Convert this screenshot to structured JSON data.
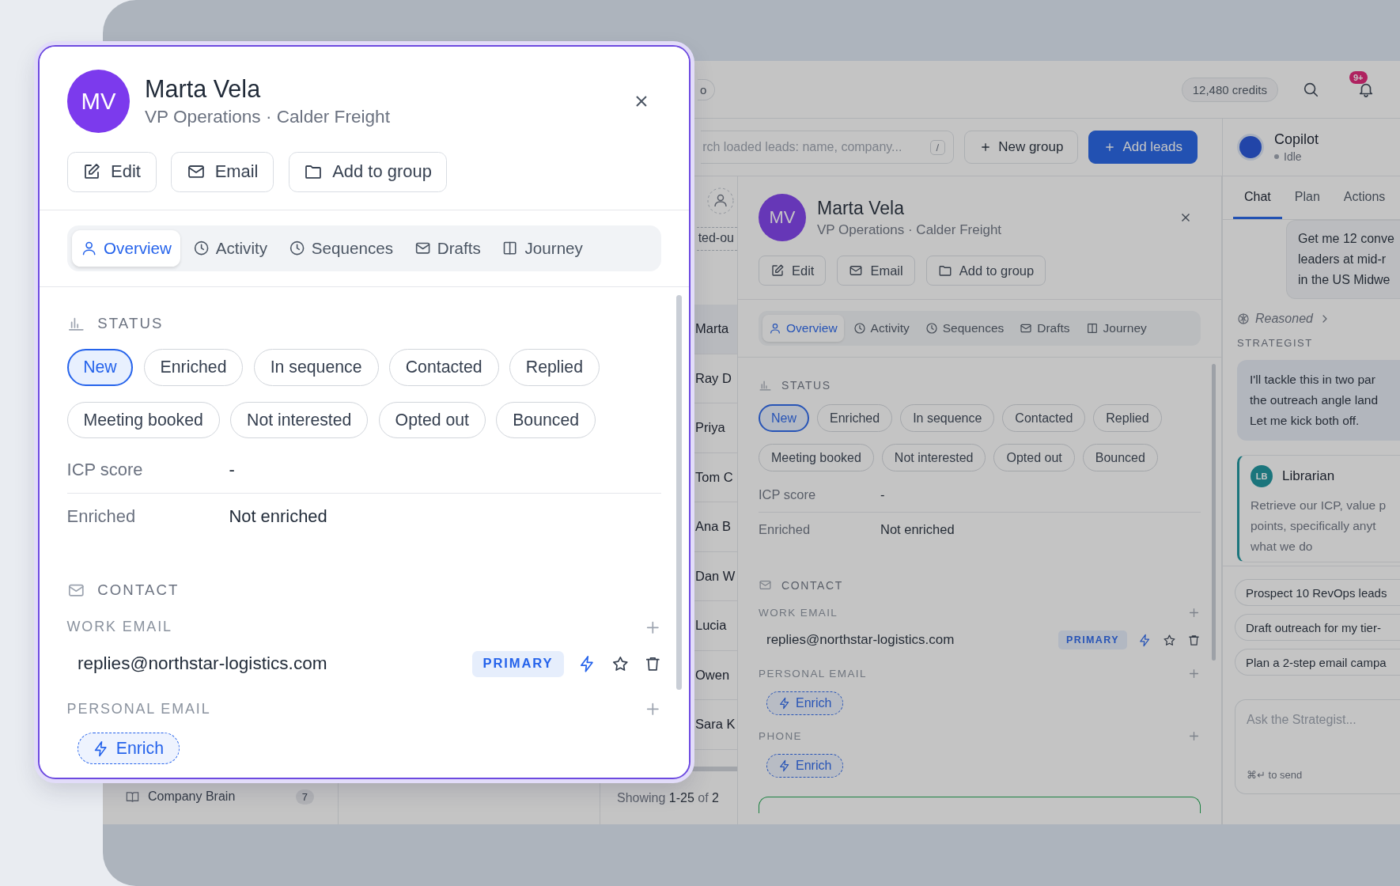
{
  "callout": {
    "avatar": "MV",
    "name": "Marta Vela",
    "subtitle": "VP Operations · Calder Freight",
    "actions": [
      "Edit",
      "Email",
      "Add to group"
    ],
    "tabs": [
      {
        "label": "Overview",
        "selected": true
      },
      {
        "label": "Activity",
        "selected": false
      },
      {
        "label": "Sequences",
        "selected": false
      },
      {
        "label": "Drafts",
        "selected": false
      },
      {
        "label": "Journey",
        "selected": false
      }
    ],
    "status": {
      "heading": "STATUS",
      "options": [
        {
          "label": "New",
          "selected": true
        },
        {
          "label": "Enriched",
          "selected": false
        },
        {
          "label": "In sequence",
          "selected": false
        },
        {
          "label": "Contacted",
          "selected": false
        },
        {
          "label": "Replied",
          "selected": false
        },
        {
          "label": "Meeting booked",
          "selected": false
        },
        {
          "label": "Not interested",
          "selected": false
        },
        {
          "label": "Opted out",
          "selected": false
        },
        {
          "label": "Bounced",
          "selected": false
        }
      ]
    },
    "fields": [
      {
        "label": "ICP score",
        "value": "-"
      },
      {
        "label": "Enriched",
        "value": "Not enriched"
      }
    ],
    "contact": {
      "heading": "CONTACT",
      "groups": [
        {
          "label": "WORK EMAIL",
          "kind": "email",
          "value": "replies@northstar-logistics.com",
          "badge": "PRIMARY"
        },
        {
          "label": "PERSONAL EMAIL",
          "kind": "enrich",
          "action": "Enrich"
        }
      ]
    }
  },
  "app": {
    "top_bar": {
      "pill_text": "o",
      "credits": "12,480 credits",
      "notifications": "9+"
    },
    "toolbar": {
      "search_placeholder": "rch loaded leads: name, company...",
      "shortcut": "/",
      "buttons": [
        {
          "label": "New group",
          "primary": false
        },
        {
          "label": "Add leads",
          "primary": true
        }
      ]
    },
    "sidebar": {
      "items": [
        {
          "label": "Company Brain",
          "count": "7"
        }
      ]
    },
    "leads": {
      "filter_chip": "ted-ou",
      "rows": [
        {
          "name": "Marta",
          "selected": true
        },
        {
          "name": "Ray D",
          "selected": false
        },
        {
          "name": "Priya",
          "selected": false
        },
        {
          "name": "Tom C",
          "selected": false
        },
        {
          "name": "Ana B",
          "selected": false
        },
        {
          "name": "Dan W",
          "selected": false
        },
        {
          "name": "Lucia",
          "selected": false
        },
        {
          "name": "Owen",
          "selected": false
        },
        {
          "name": "Sara K",
          "selected": false
        }
      ],
      "footer": "Showing **1-25** of **2**"
    },
    "detail": {
      "avatar": "MV",
      "name": "Marta Vela",
      "subtitle": "VP Operations · Calder Freight",
      "actions": [
        "Edit",
        "Email",
        "Add to group"
      ],
      "tabs": [
        {
          "label": "Overview",
          "selected": true
        },
        {
          "label": "Activity",
          "selected": false
        },
        {
          "label": "Sequences",
          "selected": false
        },
        {
          "label": "Drafts",
          "selected": false
        },
        {
          "label": "Journey",
          "selected": false
        }
      ],
      "status": {
        "heading": "STATUS",
        "options": [
          {
            "label": "New",
            "selected": true
          },
          {
            "label": "Enriched",
            "selected": false
          },
          {
            "label": "In sequence",
            "selected": false
          },
          {
            "label": "Contacted",
            "selected": false
          },
          {
            "label": "Replied",
            "selected": false
          },
          {
            "label": "Meeting booked",
            "selected": false
          },
          {
            "label": "Not interested",
            "selected": false
          },
          {
            "label": "Opted out",
            "selected": false
          },
          {
            "label": "Bounced",
            "selected": false
          }
        ]
      },
      "fields": [
        {
          "label": "ICP score",
          "value": "-"
        },
        {
          "label": "Enriched",
          "value": "Not enriched"
        }
      ],
      "contact": {
        "heading": "CONTACT",
        "groups": [
          {
            "label": "WORK EMAIL",
            "kind": "email",
            "value": "replies@northstar-logistics.com",
            "badge": "PRIMARY"
          },
          {
            "label": "PERSONAL EMAIL",
            "kind": "enrich",
            "action": "Enrich"
          },
          {
            "label": "PHONE",
            "kind": "enrich",
            "action": "Enrich"
          }
        ]
      }
    },
    "copilot": {
      "title": "Copilot",
      "status": "Idle",
      "tabs": [
        {
          "label": "Chat",
          "selected": true
        },
        {
          "label": "Plan",
          "selected": false
        },
        {
          "label": "Actions",
          "selected": false
        }
      ],
      "user_message": [
        "Get me 12 conve",
        "leaders at mid-r",
        "in the US Midwe"
      ],
      "reasoning": "Reasoned",
      "speaker": "STRATEGIST",
      "assistant_message": [
        "I'll tackle this in two par",
        "the outreach angle land",
        "Let me kick both off."
      ],
      "delegation": {
        "avatar": "LB",
        "name": "Librarian",
        "lines": [
          "Retrieve our ICP, value p",
          "points, specifically anyt",
          "what we do"
        ]
      },
      "suggestions": [
        "Prospect 10 RevOps leads",
        "Draft outreach for my tier-",
        "Plan a 2-step email campa"
      ],
      "input": {
        "placeholder": "Ask the Strategist...",
        "hint": "⌘↵ to send"
      }
    }
  }
}
